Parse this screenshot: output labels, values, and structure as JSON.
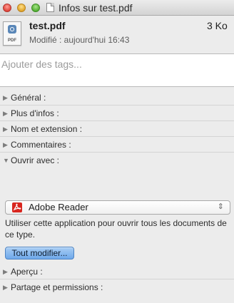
{
  "window": {
    "title": "Infos sur test.pdf",
    "controls": {
      "close": "close",
      "minimize": "minimize",
      "zoom": "zoom"
    }
  },
  "file": {
    "name": "test.pdf",
    "size": "3 Ko",
    "modified": "Modifié : aujourd'hui 16:43",
    "icon_label": "PDF"
  },
  "tags": {
    "placeholder": "Ajouter des tags..."
  },
  "sections": [
    {
      "label": "Général :",
      "expanded": false
    },
    {
      "label": "Plus d'infos :",
      "expanded": false
    },
    {
      "label": "Nom et extension :",
      "expanded": false
    },
    {
      "label": "Commentaires :",
      "expanded": false
    },
    {
      "label": "Ouvrir avec :",
      "expanded": true
    },
    {
      "label": "Aperçu :",
      "expanded": false
    },
    {
      "label": "Partage et permissions :",
      "expanded": false
    }
  ],
  "open_with": {
    "selected_app": "Adobe Reader",
    "help_text": "Utiliser cette application pour ouvrir tous les documents de ce type.",
    "change_all_label": "Tout modifier..."
  },
  "icons": {
    "collapsed": "▶",
    "expanded": "▼",
    "select_arrows": "⇕"
  },
  "colors": {
    "accent": "#6ea8ea",
    "adobe_red": "#d8261f",
    "placeholder_gray": "#9b9b9b"
  }
}
